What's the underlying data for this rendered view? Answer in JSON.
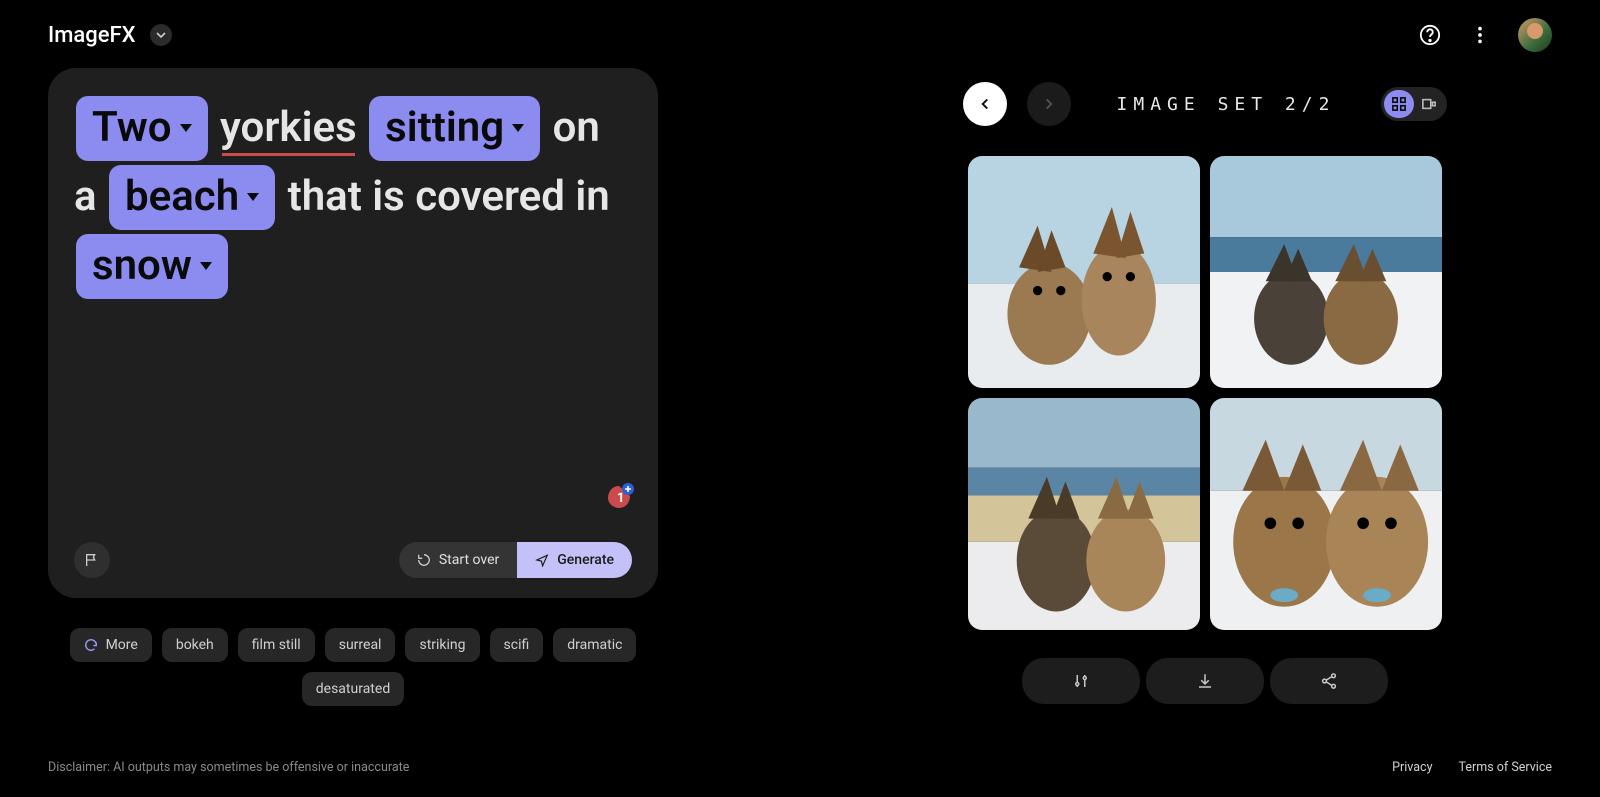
{
  "app": {
    "name": "ImageFX"
  },
  "prompt": {
    "tokens": [
      {
        "text": "Two",
        "chip": true
      },
      {
        "text": "yorkies",
        "chip": false,
        "underlined": true
      },
      {
        "text": "sitting",
        "chip": true
      },
      {
        "text": "on a",
        "chip": false
      },
      {
        "text": "beach",
        "chip": true
      },
      {
        "text": "that is covered in",
        "chip": false
      },
      {
        "text": "snow",
        "chip": true
      }
    ],
    "start_over": "Start over",
    "generate": "Generate"
  },
  "styles": {
    "more": "More",
    "items": [
      "bokeh",
      "film still",
      "surreal",
      "striking",
      "scifi",
      "dramatic",
      "desaturated"
    ]
  },
  "set": {
    "label": "IMAGE SET 2/2"
  },
  "disclaimer": "Disclaimer: AI outputs may sometimes be offensive or inaccurate",
  "footer": {
    "privacy": "Privacy",
    "tos": "Terms of Service"
  },
  "icons": {
    "help": "help-icon",
    "menu": "more-vert-icon",
    "flag": "flag-icon",
    "refresh": "refresh-icon",
    "send": "send-icon",
    "grid": "grid-icon",
    "single": "single-icon",
    "tune": "tune-icon",
    "download": "download-icon",
    "share": "share-icon"
  }
}
